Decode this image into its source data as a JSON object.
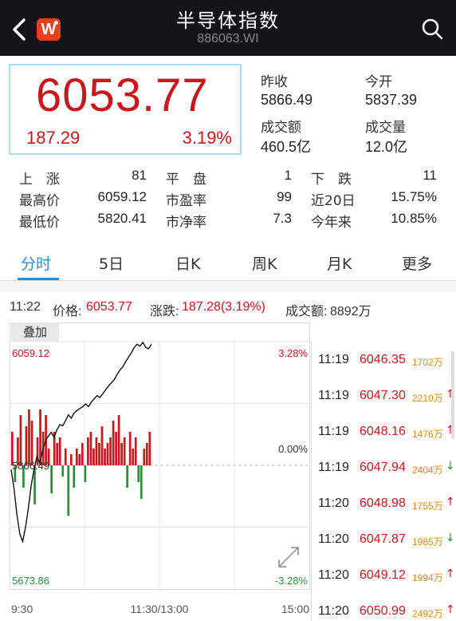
{
  "header": {
    "title": "半导体指数",
    "code": "886063.WI",
    "logo_text": "W"
  },
  "quote": {
    "price": "6053.77",
    "change": "187.29",
    "change_pct": "3.19%"
  },
  "stats": [
    {
      "label": "昨收",
      "value": "5866.49"
    },
    {
      "label": "今开",
      "value": "5837.39"
    },
    {
      "label": "成交额",
      "value": "460.5亿"
    },
    {
      "label": "成交量",
      "value": "12.0亿"
    }
  ],
  "breadth": [
    {
      "c1": "上　涨",
      "v1": "81",
      "c2": "平　盘",
      "v2": "1",
      "c3": "下　跌",
      "v3": "11"
    },
    {
      "c1": "最高价",
      "v1": "6059.12",
      "c2": "市盈率",
      "v2": "99",
      "c3": "近20日",
      "v3": "15.75%"
    },
    {
      "c1": "最低价",
      "v1": "5820.41",
      "c2": "市净率",
      "v2": "7.3",
      "c3": "今年来",
      "v3": "10.85%"
    }
  ],
  "tabs": [
    "分时",
    "5日",
    "日K",
    "周K",
    "月K",
    "更多"
  ],
  "info": {
    "time": "11:22",
    "price_label": "价格:",
    "price": "6053.77",
    "chg_label": "涨跌:",
    "chg": "187.28(3.19%)",
    "amt_label": "成交额:",
    "amt": "8892万"
  },
  "overlay_label": "叠加",
  "chart_data": {
    "type": "line",
    "y_high": "6059.12",
    "y_mid": "5866.49",
    "y_low": "5673.86",
    "pct_high": "3.28%",
    "pct_mid": "0.00%",
    "pct_low": "-3.28%",
    "x_labels": [
      "9:30",
      "11:30/13:00",
      "15:00"
    ],
    "ylim": [
      5673.86,
      6059.12
    ],
    "price_series": [
      5860,
      5830,
      5790,
      5760,
      5748,
      5770,
      5800,
      5835,
      5860,
      5880,
      5870,
      5890,
      5905,
      5912,
      5918,
      5910,
      5922,
      5930,
      5928,
      5936,
      5945,
      5940,
      5948,
      5952,
      5955,
      5958,
      5962,
      5958,
      5965,
      5970,
      5975,
      5972,
      5978,
      5984,
      5990,
      5995,
      6000,
      6008,
      6015,
      6020,
      6028,
      6035,
      6042,
      6050,
      6055,
      6052,
      6058,
      6050,
      6048,
      6055
    ],
    "volume_bars": [
      0.6,
      -0.3,
      0.5,
      0.9,
      -0.4,
      0.7,
      1.0,
      0.8,
      -0.7,
      0.5,
      1.0,
      0.6,
      0.9,
      0.3,
      -0.5,
      0.6,
      0.4,
      0.5,
      -0.2,
      0.3,
      -0.9,
      0.2,
      -0.4,
      0.3,
      0.2,
      0.4,
      -0.3,
      0.5,
      0.6,
      0.3,
      0.5,
      0.4,
      0.7,
      0.3,
      0.4,
      0.5,
      0.8,
      0.6,
      0.9,
      0.4,
      0.5,
      -0.4,
      0.6,
      0.3,
      0.5,
      -0.3,
      -0.6,
      0.3,
      0.4,
      0.6
    ]
  },
  "ticks": [
    {
      "time": "11:19",
      "price": "6046.35",
      "vol": "1702万",
      "arrow": ""
    },
    {
      "time": "11:19",
      "price": "6047.30",
      "vol": "2210万",
      "arrow": "↑"
    },
    {
      "time": "11:19",
      "price": "6048.16",
      "vol": "1476万",
      "arrow": "↑"
    },
    {
      "time": "11:19",
      "price": "6047.94",
      "vol": "2404万",
      "arrow": "↓"
    },
    {
      "time": "11:20",
      "price": "6048.98",
      "vol": "1755万",
      "arrow": "↑"
    },
    {
      "time": "11:20",
      "price": "6047.87",
      "vol": "1985万",
      "arrow": "↓"
    },
    {
      "time": "11:20",
      "price": "6049.12",
      "vol": "1994万",
      "arrow": "↑"
    },
    {
      "time": "11:20",
      "price": "6050.99",
      "vol": "2492万",
      "arrow": "↑"
    }
  ],
  "colors": {
    "up": "#c9171d",
    "down": "#2e8b3a",
    "accent": "#2a8bd6"
  }
}
